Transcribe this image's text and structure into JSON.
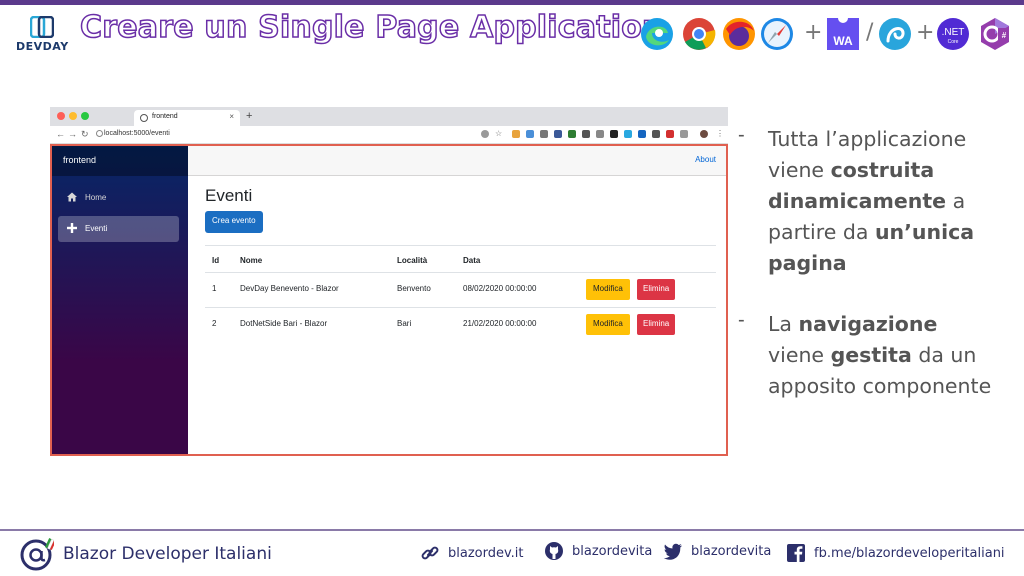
{
  "slide": {
    "title": "Creare un Single Page Application",
    "logo_text": "DEVDAY",
    "tech_icons": [
      "edge-icon",
      "chrome-icon",
      "firefox-icon",
      "safari-icon",
      "webassembly-icon",
      "blazor-icon",
      "dotnet-core-icon",
      "csharp-icon"
    ],
    "plus1": "+",
    "slash": "/",
    "plus2": "+",
    "wa_label": "WA",
    "net_label": ".NET",
    "core_label": "Core"
  },
  "browser": {
    "tab_title": "frontend",
    "tab_close": "×",
    "new_tab": "+",
    "url": "localhost:5000/eventi"
  },
  "app": {
    "brand": "frontend",
    "nav": [
      {
        "label": "Home",
        "icon": "home-icon"
      },
      {
        "label": "Eventi",
        "icon": "plus-icon"
      }
    ],
    "about": "About",
    "heading": "Eventi",
    "new_button": "Crea evento",
    "table": {
      "headers": [
        "Id",
        "Nome",
        "Località",
        "Data"
      ],
      "rows": [
        {
          "id": "1",
          "nome": "DevDay Benevento - Blazor",
          "localita": "Benvento",
          "data": "08/02/2020 00:00:00"
        },
        {
          "id": "2",
          "nome": "DotNetSide Bari - Blazor",
          "localita": "Bari",
          "data": "21/02/2020 00:00:00"
        }
      ],
      "edit_label": "Modifica",
      "delete_label": "Elimina"
    }
  },
  "bullets": [
    {
      "dash": "-",
      "parts": [
        "Tutta l’applicazione viene ",
        "costruita dinamicamente",
        " a partire da ",
        "un’unica pagina",
        ""
      ]
    },
    {
      "dash": "-",
      "parts": [
        "La ",
        "navigazione",
        " viene ",
        "gestita",
        " da un apposito componente"
      ]
    }
  ],
  "footer": {
    "brand": "Blazor Developer Italiani",
    "site": "blazordev.it",
    "github": "blazordevita",
    "twitter": "blazordevita",
    "facebook": "fb.me/blazordeveloperitaliani"
  },
  "colors": {
    "title_stroke": "#6a2ea7",
    "sidebar_top": "#052767",
    "sidebar_bottom": "#3a0647",
    "primary_button": "#1b6ec2",
    "warning_button": "#ffc107",
    "danger_button": "#dc3545",
    "viewport_border": "#e06050"
  }
}
